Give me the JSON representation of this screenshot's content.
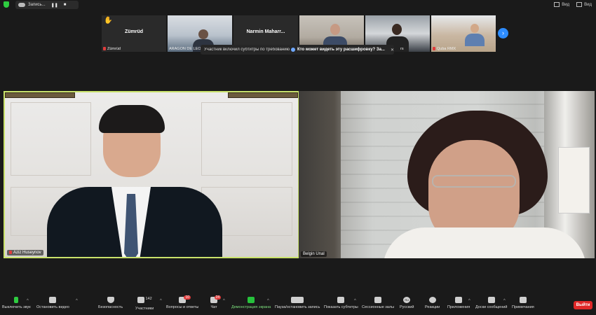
{
  "topbar": {
    "recording_label": "Запись...",
    "pause_symbol": "❚❚",
    "stop_symbol": "■",
    "view_label_1": "Вид",
    "view_label_2": "Вид"
  },
  "thumbnails": [
    {
      "center_name": "Zümrüd",
      "label": "Zümrüd",
      "muted": true,
      "raised_hand": true
    },
    {
      "center_name": "",
      "label": "ARAGON DE LEO",
      "muted": false,
      "raised_hand": false
    },
    {
      "center_name": "Narmin Maharr...",
      "label": "Narmin Maharramova",
      "muted": true,
      "raised_hand": false
    },
    {
      "center_name": "",
      "label": "",
      "muted": false,
      "raised_hand": false
    },
    {
      "center_name": "",
      "label": "rs",
      "muted": false,
      "raised_hand": false
    },
    {
      "center_name": "",
      "label": "Quba RMX",
      "muted": true,
      "raised_hand": false
    }
  ],
  "next_icon": "›",
  "notification": {
    "left_text": "Участник включил субтитры по требованию",
    "right_text": "Кто может видеть эту расшифровку? За...",
    "close_symbol": "✕"
  },
  "main_videos": [
    {
      "name": "Aziz Huseynov",
      "muted": true,
      "active_speaker": true
    },
    {
      "name": "Belgin Unal",
      "muted": false,
      "active_speaker": false
    }
  ],
  "toolbar": {
    "items": [
      {
        "label": "Выключить звук",
        "icon": "mic-icon"
      },
      {
        "label": "Остановить видео",
        "icon": "video-camera-icon"
      },
      {
        "label": "Безопасность",
        "icon": "shield-icon"
      },
      {
        "label": "Участники",
        "icon": "participants-icon",
        "count": "142"
      },
      {
        "label": "Вопросы и ответы",
        "icon": "qa-icon",
        "badge": "10"
      },
      {
        "label": "Чат",
        "icon": "chat-icon",
        "badge": "24"
      },
      {
        "label": "Демонстрация экрана",
        "icon": "share-screen-icon"
      },
      {
        "label": "Пауза/остановить запись",
        "icon": "record-pause-icon"
      },
      {
        "label": "Показать субтитры",
        "icon": "cc-icon"
      },
      {
        "label": "Сессионные залы",
        "icon": "breakout-rooms-icon"
      },
      {
        "label": "Русский",
        "icon": "interpretation-icon",
        "icon_text": "RU"
      },
      {
        "label": "Реакции",
        "icon": "reactions-icon"
      },
      {
        "label": "Приложения",
        "icon": "apps-icon"
      },
      {
        "label": "Доски сообщений",
        "icon": "whiteboard-icon"
      },
      {
        "label": "Примечания",
        "icon": "notes-icon"
      }
    ],
    "leave_label": "Выйти"
  },
  "colors": {
    "background": "#1a1a1a",
    "active_speaker_border": "#c9e26b",
    "leave_button": "#e02828",
    "share_screen_icon": "#26c23c",
    "next_button": "#2d8cff"
  }
}
